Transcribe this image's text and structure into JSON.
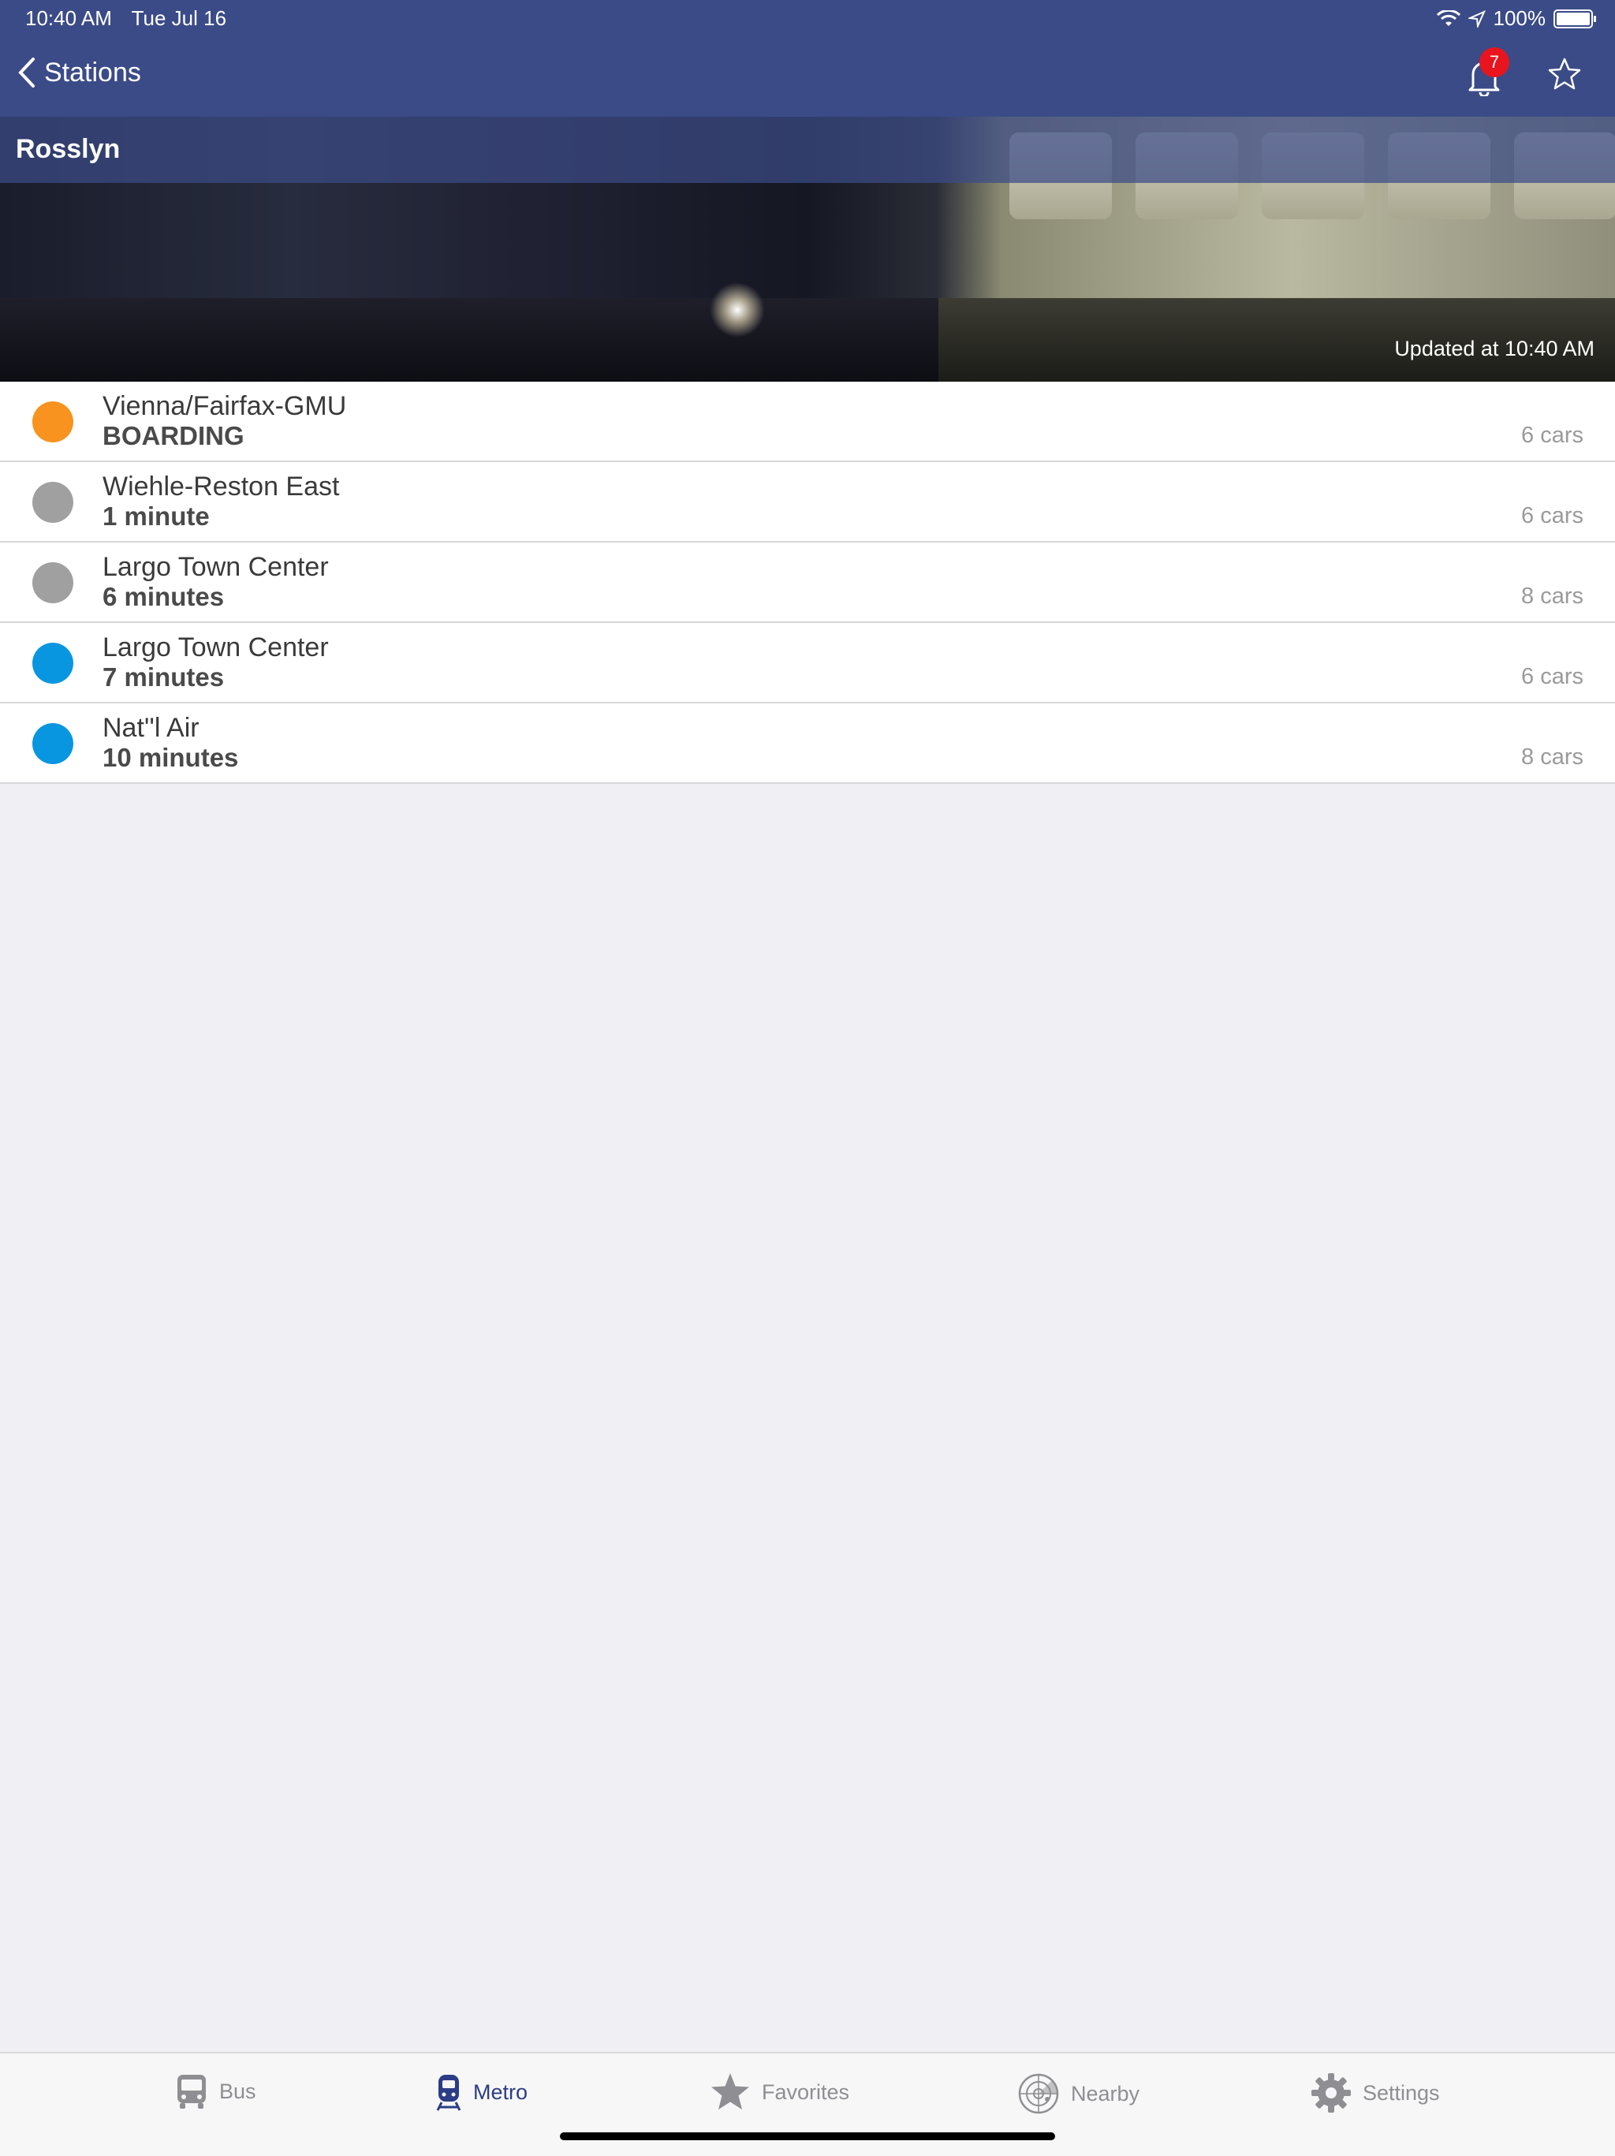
{
  "status_bar": {
    "time": "10:40 AM",
    "date": "Tue Jul 16",
    "battery": "100%"
  },
  "nav": {
    "back_label": "Stations",
    "notification_count": "7"
  },
  "station": {
    "name": "Rosslyn",
    "updated": "Updated at 10:40 AM"
  },
  "arrivals": [
    {
      "destination": "Vienna/Fairfax-GMU",
      "eta": "BOARDING",
      "cars": "6 cars",
      "line_color": "#f7931e"
    },
    {
      "destination": "Wiehle-Reston East",
      "eta": "1 minute",
      "cars": "6 cars",
      "line_color": "#a0a0a0"
    },
    {
      "destination": "Largo Town Center",
      "eta": "6 minutes",
      "cars": "8 cars",
      "line_color": "#a0a0a0"
    },
    {
      "destination": "Largo Town Center",
      "eta": "7 minutes",
      "cars": "6 cars",
      "line_color": "#0996e0"
    },
    {
      "destination": "Nat''l Air",
      "eta": "10 minutes",
      "cars": "8 cars",
      "line_color": "#0996e0"
    }
  ],
  "tabs": [
    {
      "label": "Bus",
      "icon": "bus-icon"
    },
    {
      "label": "Metro",
      "icon": "metro-train-icon",
      "active": true
    },
    {
      "label": "Favorites",
      "icon": "star-icon"
    },
    {
      "label": "Nearby",
      "icon": "radar-icon"
    },
    {
      "label": "Settings",
      "icon": "gear-icon"
    }
  ],
  "colors": {
    "nav_background": "#3b4b87",
    "active_tab": "#2c3d86",
    "badge": "#e8151f"
  }
}
